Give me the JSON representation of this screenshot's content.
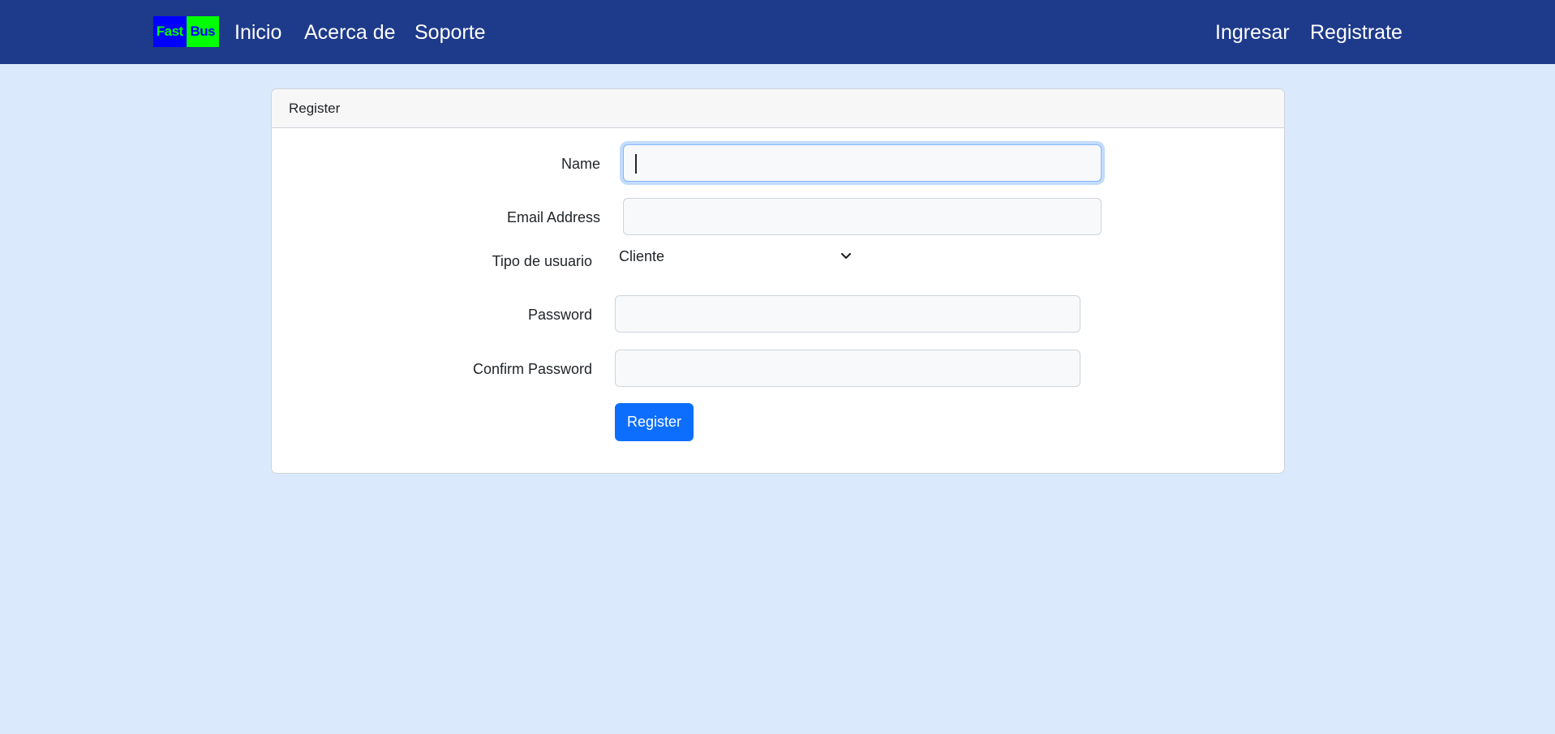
{
  "navbar": {
    "logo_left": "Fast",
    "logo_right": "Bus",
    "links": [
      "Inicio",
      "Acerca de",
      "Soporte"
    ],
    "ingresar": "Ingresar",
    "registrate": "Registrate"
  },
  "card": {
    "header": "Register",
    "fields": {
      "name_label": "Name",
      "email_label": "Email Address",
      "tipo_label": "Tipo de usuario",
      "tipo_value": "Cliente",
      "password_label": "Password",
      "confirm_label": "Confirm Password"
    },
    "register_button": "Register"
  },
  "colors": {
    "navbar": "#1e3a8a",
    "page_background": "#dbe9fd",
    "primary_button": "#0d6efd",
    "logo_blue": "#0000ff",
    "logo_green": "#00ff00"
  },
  "icons": {
    "select_arrow": "chevron-down-icon"
  }
}
